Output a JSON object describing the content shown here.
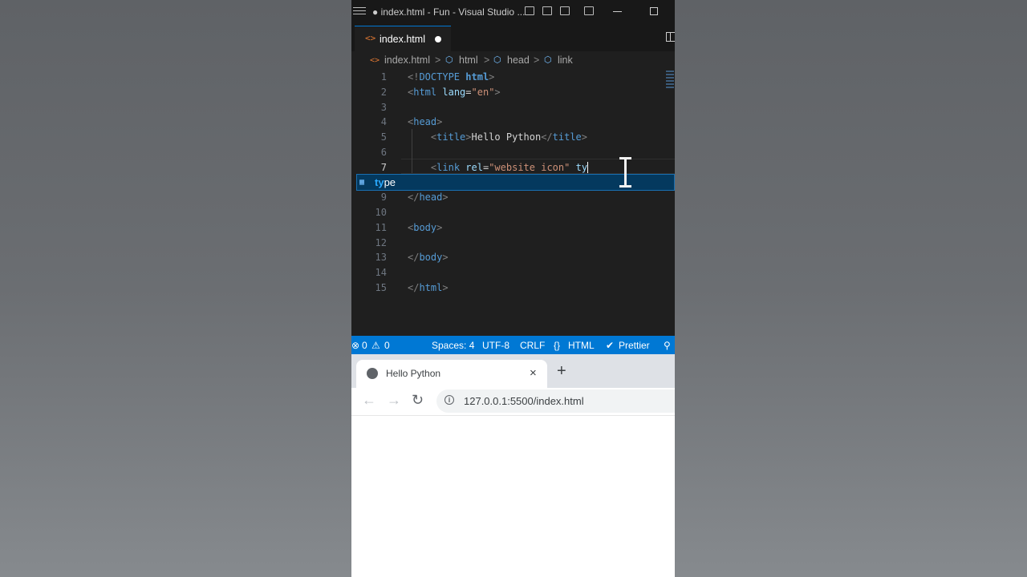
{
  "window": {
    "title": "● index.html - Fun - Visual Studio ..."
  },
  "editor_tab": {
    "file_icon": "<>",
    "name": "index.html"
  },
  "breadcrumbs": {
    "file": "index.html",
    "items": [
      "html",
      "head",
      "link"
    ],
    "separator": ">"
  },
  "code_lines": [
    {
      "num": "1"
    },
    {
      "num": "2"
    },
    {
      "num": "3"
    },
    {
      "num": "4"
    },
    {
      "num": "5"
    },
    {
      "num": "6"
    },
    {
      "num": "7"
    },
    {
      "num": "9"
    },
    {
      "num": "10"
    },
    {
      "num": "11"
    },
    {
      "num": "12"
    },
    {
      "num": "13"
    },
    {
      "num": "14"
    },
    {
      "num": "15"
    }
  ],
  "code": {
    "l1": {
      "open": "<!",
      "doctype": "DOCTYPE",
      "html": "html",
      "close": ">"
    },
    "l2": {
      "open": "<",
      "tag": "html",
      "attr": "lang",
      "eq": "=",
      "val": "\"en\"",
      "close": ">"
    },
    "l4": {
      "open": "<",
      "tag": "head",
      "close": ">"
    },
    "l5": {
      "open": "<",
      "tag": "title",
      "close": ">",
      "text": "Hello Python",
      "open2": "</",
      "tag2": "title",
      "close2": ">"
    },
    "l7": {
      "open": "<",
      "tag": "link",
      "attr": "rel",
      "eq": "=",
      "val": "\"website icon\"",
      "typed": "ty"
    },
    "l9": {
      "open": "</",
      "tag": "head",
      "close": ">"
    },
    "l11": {
      "open": "<",
      "tag": "body",
      "close": ">"
    },
    "l13": {
      "open": "</",
      "tag": "body",
      "close": ">"
    },
    "l15": {
      "open": "</",
      "tag": "html",
      "close": ">"
    }
  },
  "suggestion": {
    "match": "ty",
    "rest": "pe",
    "icon": "attribute-icon"
  },
  "status_bar": {
    "errors": "0",
    "warnings": "0",
    "spaces": "Spaces: 4",
    "encoding": "UTF-8",
    "eol": "CRLF",
    "language": "HTML",
    "formatter": "Prettier"
  },
  "browser": {
    "tab_title": "Hello Python",
    "close": "×",
    "new_tab": "+",
    "url": "127.0.0.1:5500/index.html",
    "back": "←",
    "forward": "→",
    "reload": "↻"
  },
  "colors": {
    "editor_bg": "#1f1f1f",
    "status_bar": "#0078d4",
    "tag": "#569cd6",
    "attr": "#9cdcfe",
    "string": "#ce9178",
    "suggest_highlight": "#04395e"
  }
}
